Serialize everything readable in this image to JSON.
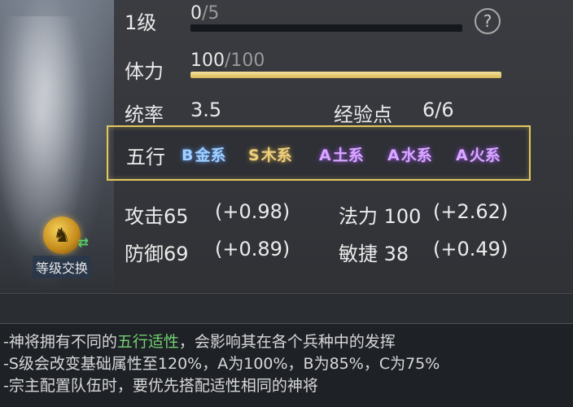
{
  "swap": {
    "label": "等级交换"
  },
  "level": {
    "label": "1级",
    "current": "0",
    "max": "/5",
    "progress": 0
  },
  "stamina": {
    "label": "体力",
    "current": "100",
    "max": "/100",
    "progress": 1.0
  },
  "leadership": {
    "label": "统率",
    "value": "3.5"
  },
  "exp_points": {
    "label": "经验点",
    "value": "6/6"
  },
  "wuxing": {
    "title": "五行",
    "items": [
      {
        "grade": "B",
        "element": "金系",
        "color": "#9fd0ff"
      },
      {
        "grade": "S",
        "element": "木系",
        "color": "#ecd080"
      },
      {
        "grade": "A",
        "element": "土系",
        "color": "#d9a8ff"
      },
      {
        "grade": "A",
        "element": "水系",
        "color": "#d9a8ff"
      },
      {
        "grade": "A",
        "element": "火系",
        "color": "#d9a8ff"
      }
    ]
  },
  "stats": {
    "attack": {
      "label": "攻击",
      "value": "65",
      "bonus": "(+0.98)"
    },
    "magic": {
      "label": "法力",
      "value": "100",
      "bonus": "(+2.62)"
    },
    "defense": {
      "label": "防御",
      "value": "69",
      "bonus": "(+0.89)"
    },
    "agility": {
      "label": "敏捷",
      "value": "38",
      "bonus": "(+0.49)"
    }
  },
  "info": {
    "line1_prefix": "-神将拥有不同的",
    "line1_highlight": "五行适性",
    "line1_suffix": "，会影响其在各个兵种中的发挥",
    "line2": "-S级会改变基础属性至120%，A为100%，B为85%，C为75%",
    "line3": "-宗主配置队伍时，要优先搭配适性相同的神将"
  },
  "icons": {
    "help": "help-icon",
    "swap": "swap-emblem-icon"
  }
}
